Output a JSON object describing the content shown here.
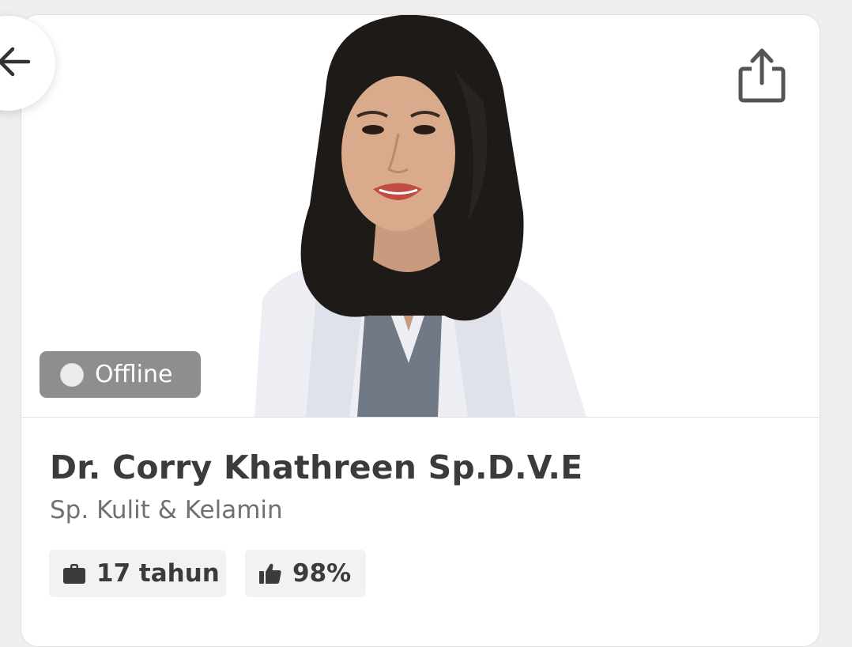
{
  "profile": {
    "status": "Offline",
    "name": "Dr. Corry Khathreen Sp.D.V.E",
    "specialty": "Sp. Kulit & Kelamin",
    "experience": "17 tahun",
    "rating": "98%"
  },
  "icons": {
    "back": "arrow-left-icon",
    "share": "share-icon",
    "experience": "briefcase-icon",
    "rating": "thumbs-up-icon",
    "status": "status-dot-icon"
  },
  "colors": {
    "status_badge": "#8e8e8e",
    "name_text": "#3b3b3b",
    "specialty_text": "#707070",
    "chip_background": "#f2f2f2"
  }
}
